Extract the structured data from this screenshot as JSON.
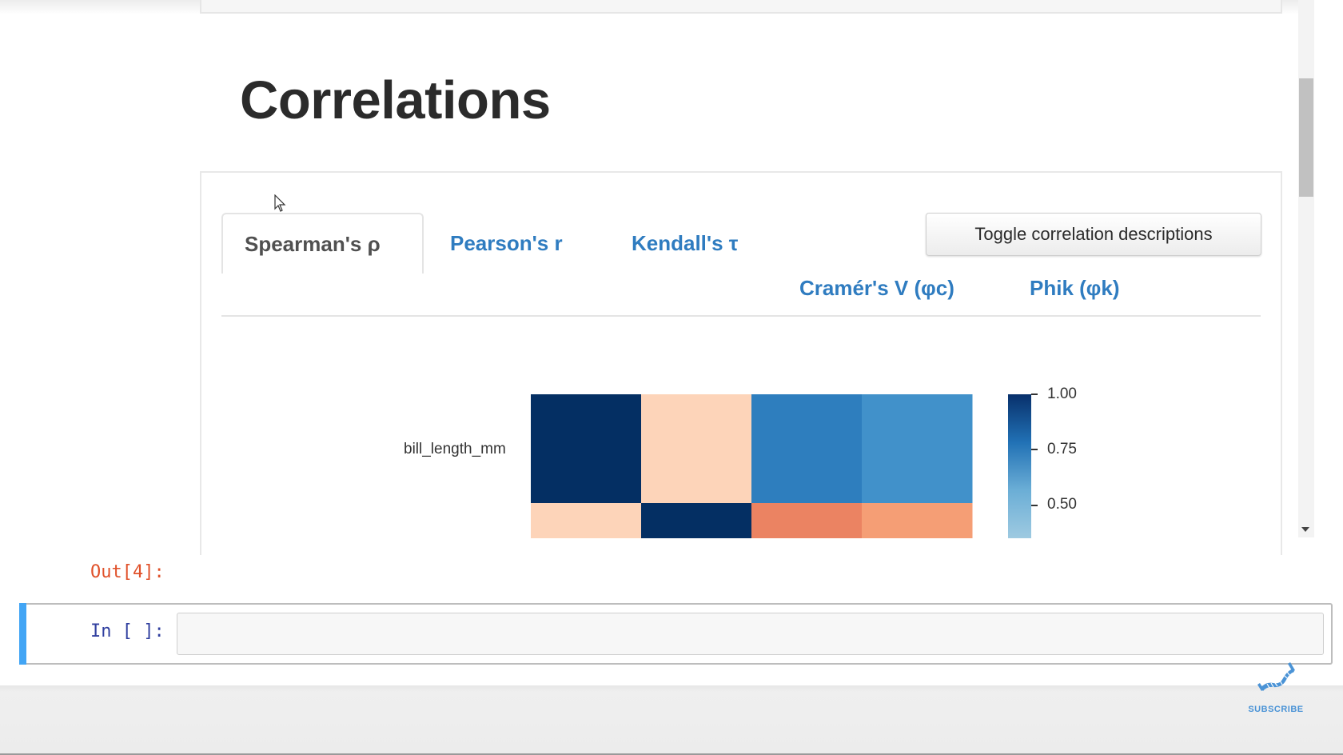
{
  "page": {
    "title": "Correlations"
  },
  "tabs": [
    {
      "label": "Spearman's ρ",
      "active": true
    },
    {
      "label": "Pearson's r",
      "active": false
    },
    {
      "label": "Kendall's τ",
      "active": false
    },
    {
      "label": "Cramér's V (φc)",
      "active": false
    },
    {
      "label": "Phik (φk)",
      "active": false
    }
  ],
  "toggle_button": {
    "label": "Toggle correlation descriptions"
  },
  "heatmap": {
    "row_labels_visible": [
      "bill_length_mm"
    ],
    "colorbar_ticks": [
      "1.00",
      "0.75",
      "0.50"
    ],
    "colors": {
      "row1": [
        "#042f63",
        "#fdd4b9",
        "#2e7ebe",
        "#4191ca"
      ],
      "row2": [
        "#fdd4b9",
        "#042f63",
        "#eb8362",
        "#f59e75"
      ]
    },
    "colorbar_colors": [
      "#08306b",
      "#2171b5",
      "#6baed6",
      "#9ecae1"
    ]
  },
  "notebook": {
    "out_prompt": "Out[4]:",
    "in_prompt": "In [ ]:",
    "cell_input_value": ""
  },
  "overlay": {
    "subscribe_label": "SUBSCRIBE",
    "icon": "dna-icon"
  },
  "colors": {
    "link": "#2f7cc0",
    "active_tab_text": "#505050",
    "out_prompt": "#e0512a",
    "in_prompt": "#303f9f",
    "cell_selected_bar": "#42a5f5"
  }
}
